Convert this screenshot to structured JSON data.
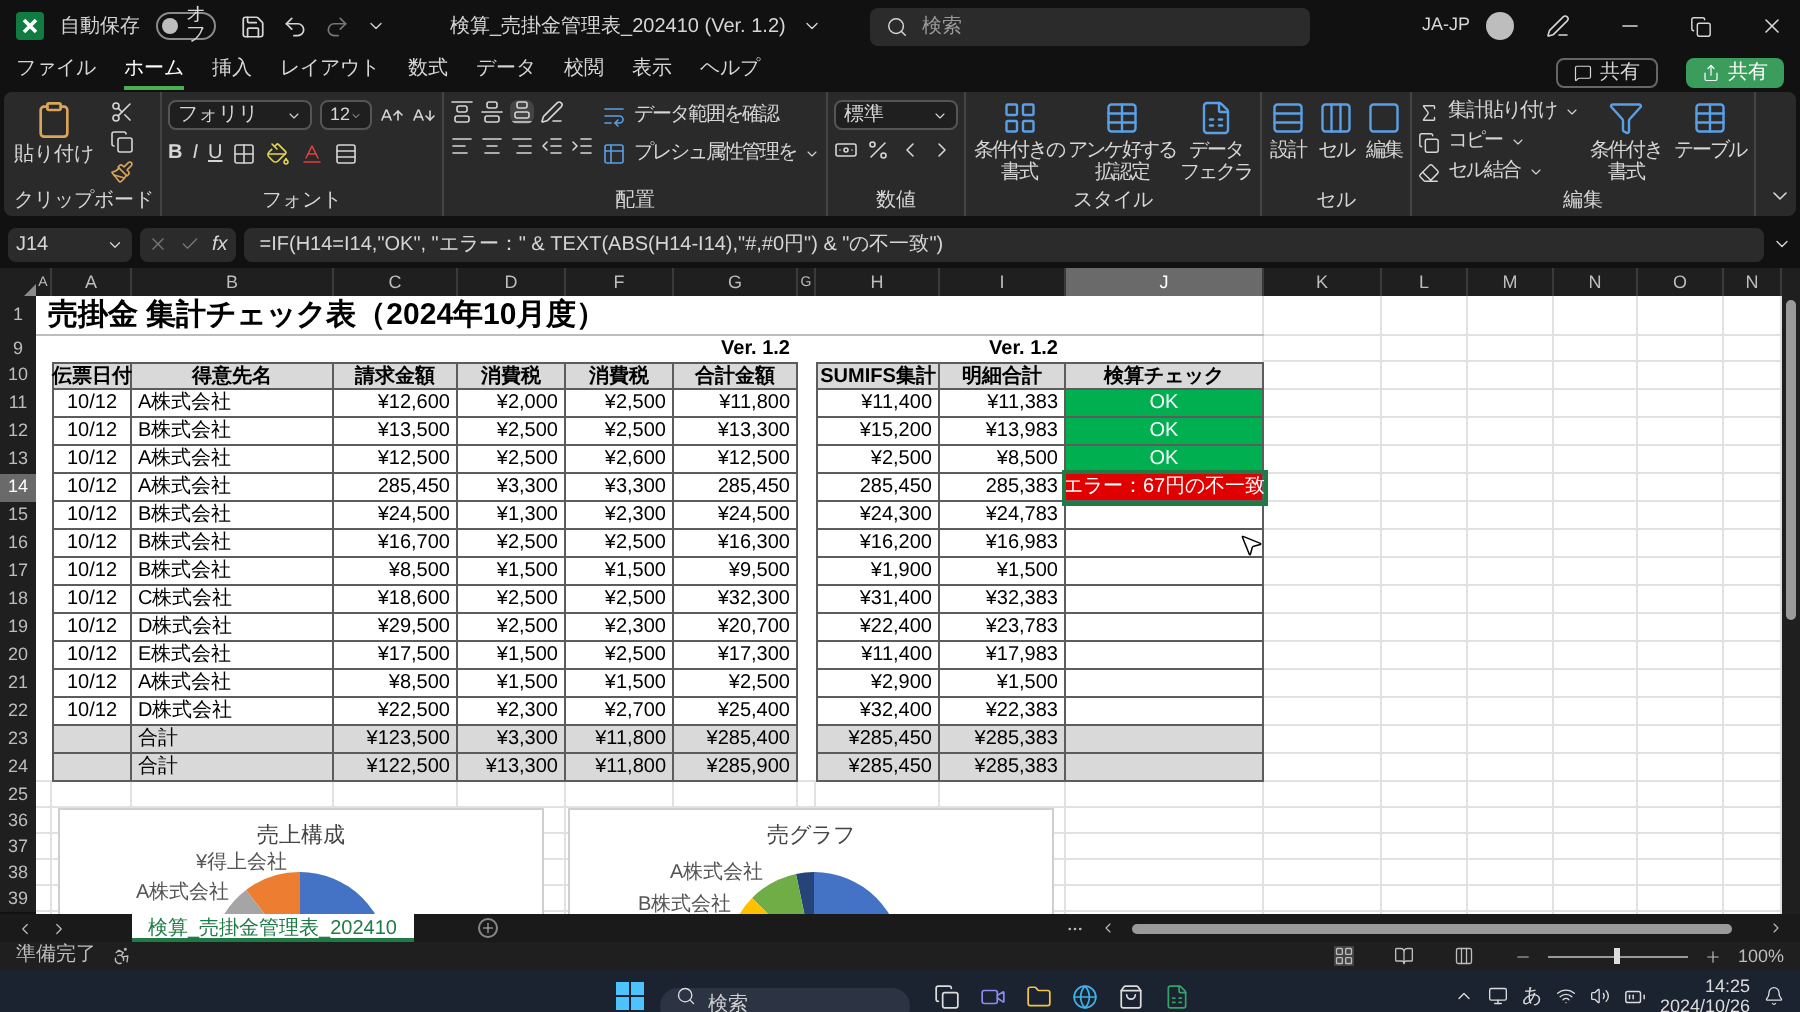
{
  "title_bar": {
    "autosave_label": "自動保存",
    "autosave": {
      "on": false,
      "label": "オフ"
    },
    "title": "検算_売掛金管理表_202410 (Ver. 1.2)",
    "search": {
      "placeholder": "検索"
    },
    "user": "JA-JP"
  },
  "menu_tabs": [
    {
      "label": "ファイル",
      "selected": false
    },
    {
      "label": "ホーム",
      "selected": true
    },
    {
      "label": "挿入",
      "selected": false
    },
    {
      "label": "レイアウト",
      "selected": false
    },
    {
      "label": "数式",
      "selected": false
    },
    {
      "label": "データ",
      "selected": false
    },
    {
      "label": "校閲",
      "selected": false
    },
    {
      "label": "表示",
      "selected": false
    },
    {
      "label": "ヘルプ",
      "selected": false
    }
  ],
  "comment_button": "共有",
  "share_button": "共有",
  "ribbon": {
    "groups": [
      {
        "kind": "clipboard",
        "label": "クリップボード",
        "paste": "貼り付け"
      },
      {
        "kind": "font",
        "label": "フォント",
        "font_name": "フォリリ",
        "font_size": "12",
        "bold": "B",
        "italic": "I",
        "underline": "U"
      },
      {
        "kind": "alignment",
        "label": "配置",
        "wrap": "データ範囲を確認",
        "merge": "プレシュ属性管理を"
      },
      {
        "kind": "number",
        "label": "数値",
        "format": "標準"
      },
      {
        "kind": "styles",
        "label": "スタイル",
        "buttons": [
          [
            "条件付きの",
            "書式"
          ],
          [
            "アンケ好する",
            "拡認定"
          ],
          [
            "データ",
            "フェクラ"
          ]
        ]
      },
      {
        "kind": "cells",
        "label": "セル",
        "buttons": [
          "設計",
          "セル",
          "編集"
        ]
      },
      {
        "kind": "editing",
        "label": "編集",
        "items": [
          "集計貼り付け",
          "コピー",
          "セル結合"
        ],
        "buttons": [
          [
            "条件付き",
            "書式"
          ],
          [
            "テーブル"
          ]
        ]
      }
    ]
  },
  "formula_bar": {
    "name_box": "J14",
    "fx": "fx",
    "formula": "=IF(H14=I14,\"OK\", \"エラー：\" & TEXT(ABS(H14-I14),\"#,#0円\") & \"の不一致\")"
  },
  "column_headers": [
    {
      "label": "A",
      "selected": false
    },
    {
      "label": "A",
      "selected": false
    },
    {
      "label": "B",
      "selected": false
    },
    {
      "label": "C",
      "selected": false
    },
    {
      "label": "D",
      "selected": false
    },
    {
      "label": "F",
      "selected": false
    },
    {
      "label": "G",
      "selected": false
    },
    {
      "label": "G",
      "selected": false
    },
    {
      "label": "H",
      "selected": false
    },
    {
      "label": "I",
      "selected": false
    },
    {
      "label": "J",
      "selected": true
    },
    {
      "label": "K",
      "selected": false
    },
    {
      "label": "L",
      "selected": false
    },
    {
      "label": "M",
      "selected": false
    },
    {
      "label": "N",
      "selected": false
    },
    {
      "label": "O",
      "selected": false
    },
    {
      "label": "N",
      "selected": false
    }
  ],
  "sheet": {
    "title_row": {
      "number": "1",
      "title": "売掛金 集計チェック表（2024年10月度）"
    },
    "version_row": {
      "number": "9",
      "labels": [
        "Ver. 1.2",
        "Ver. 1.2"
      ]
    },
    "header_row": {
      "number": "10",
      "headers": [
        "伝票日付",
        "得意先名",
        "請求金額",
        "消費税",
        "消費税",
        "合計金額",
        "SUMIFS集計",
        "明細合計",
        "検算チェック"
      ]
    },
    "rows": [
      {
        "number": "11",
        "kind": "data",
        "selected": false,
        "date": "10/12",
        "customer": "A株式会社",
        "values": [
          "¥12,600",
          "¥2,000",
          "¥2,500",
          "¥11,800"
        ],
        "sumifs": "¥11,400",
        "detail_total": "¥11,383",
        "check": {
          "kind": "ok",
          "text": "OK"
        }
      },
      {
        "number": "12",
        "kind": "data",
        "selected": false,
        "date": "10/12",
        "customer": "B株式会社",
        "values": [
          "¥13,500",
          "¥2,500",
          "¥2,500",
          "¥13,300"
        ],
        "sumifs": "¥15,200",
        "detail_total": "¥13,983",
        "check": {
          "kind": "ok",
          "text": "OK"
        }
      },
      {
        "number": "13",
        "kind": "data",
        "selected": false,
        "date": "10/12",
        "customer": "A株式会社",
        "values": [
          "¥12,500",
          "¥2,500",
          "¥2,600",
          "¥12,500"
        ],
        "sumifs": "¥2,500",
        "detail_total": "¥8,500",
        "check": {
          "kind": "ok",
          "text": "OK"
        }
      },
      {
        "number": "14",
        "kind": "data",
        "selected": true,
        "date": "10/12",
        "customer": "A株式会社",
        "values": [
          "285,450",
          "¥3,300",
          "¥3,300",
          "285,450"
        ],
        "sumifs": "285,450",
        "detail_total": "285,383",
        "check": {
          "kind": "error",
          "text": "エラー：67円の不一致"
        }
      },
      {
        "number": "15",
        "kind": "data",
        "selected": false,
        "date": "10/12",
        "customer": "B株式会社",
        "values": [
          "¥24,500",
          "¥1,300",
          "¥2,300",
          "¥24,500"
        ],
        "sumifs": "¥24,300",
        "detail_total": "¥24,783"
      },
      {
        "number": "16",
        "kind": "data",
        "selected": false,
        "date": "10/12",
        "customer": "B株式会社",
        "values": [
          "¥16,700",
          "¥2,500",
          "¥2,500",
          "¥16,300"
        ],
        "sumifs": "¥16,200",
        "detail_total": "¥16,983"
      },
      {
        "number": "17",
        "kind": "data",
        "selected": false,
        "date": "10/12",
        "customer": "B株式会社",
        "values": [
          "¥8,500",
          "¥1,500",
          "¥1,500",
          "¥9,500"
        ],
        "sumifs": "¥1,900",
        "detail_total": "¥1,500"
      },
      {
        "number": "18",
        "kind": "data",
        "selected": false,
        "date": "10/12",
        "customer": "C株式会社",
        "values": [
          "¥18,600",
          "¥2,500",
          "¥2,500",
          "¥32,300"
        ],
        "sumifs": "¥31,400",
        "detail_total": "¥32,383"
      },
      {
        "number": "19",
        "kind": "data",
        "selected": false,
        "date": "10/12",
        "customer": "D株式会社",
        "values": [
          "¥29,500",
          "¥2,500",
          "¥2,300",
          "¥20,700"
        ],
        "sumifs": "¥22,400",
        "detail_total": "¥23,783"
      },
      {
        "number": "20",
        "kind": "data",
        "selected": false,
        "date": "10/12",
        "customer": "E株式会社",
        "values": [
          "¥17,500",
          "¥1,500",
          "¥2,500",
          "¥17,300"
        ],
        "sumifs": "¥11,400",
        "detail_total": "¥17,983"
      },
      {
        "number": "21",
        "kind": "data",
        "selected": false,
        "date": "10/12",
        "customer": "A株式会社",
        "values": [
          "¥8,500",
          "¥1,500",
          "¥1,500",
          "¥2,500"
        ],
        "sumifs": "¥2,900",
        "detail_total": "¥1,500"
      },
      {
        "number": "22",
        "kind": "data",
        "selected": false,
        "date": "10/12",
        "customer": "D株式会社",
        "values": [
          "¥22,500",
          "¥2,300",
          "¥2,700",
          "¥25,400"
        ],
        "sumifs": "¥32,400",
        "detail_total": "¥22,383"
      },
      {
        "number": "23",
        "kind": "total",
        "selected": false,
        "customer": "合計",
        "values": [
          "¥123,500",
          "¥3,300",
          "¥11,800",
          "¥285,400"
        ],
        "sumifs": "¥285,450",
        "detail_total": "¥285,383"
      },
      {
        "number": "24",
        "kind": "total",
        "selected": false,
        "customer": "合計",
        "values": [
          "¥122,500",
          "¥13,300",
          "¥11,800",
          "¥285,900"
        ],
        "sumifs": "¥285,450",
        "detail_total": "¥285,383"
      }
    ],
    "blank_rows": [
      "25",
      "36",
      "37",
      "38",
      "39"
    ],
    "charts": [
      {
        "title": "売上構成",
        "labels": [
          "¥得上会社",
          "A株式会社"
        ]
      },
      {
        "title": "売グラフ",
        "labels": [
          "A株式会社",
          "B株式会社"
        ]
      }
    ]
  },
  "sheet_tab": {
    "label": "検算_売掛金管理表_202410",
    "selected": true
  },
  "status_bar": {
    "status": "準備完了",
    "zoom": {
      "level": 0.5,
      "reading": "100%"
    }
  },
  "taskbar": {
    "search": {
      "placeholder": "検索"
    },
    "ime": "あ",
    "time": "14:25",
    "date": "2024/10/26"
  }
}
